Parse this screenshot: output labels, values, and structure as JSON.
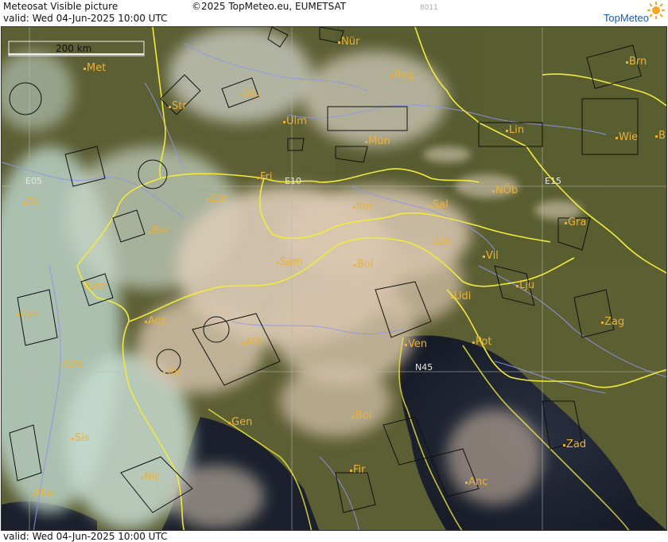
{
  "header": {
    "product": "Meteosat Visible picture",
    "copyright": "©2025 TopMeteo.eu, EUMETSAT",
    "code": "8011",
    "valid": "valid:  Wed  04-Jun-2025  10:00 UTC",
    "logo_text": "TopMeteo"
  },
  "footer": {
    "valid": "valid:  Wed  04-Jun-2025  10:00 UTC"
  },
  "scale_bar": {
    "label": "200 km"
  },
  "grid_labels": {
    "e05": "E05",
    "e10": "E10",
    "e15": "E15",
    "n45": "N45"
  },
  "cities": [
    {
      "name": "Nür"
    },
    {
      "name": "Reg"
    },
    {
      "name": "Brn"
    },
    {
      "name": "Met"
    },
    {
      "name": "Stu"
    },
    {
      "name": "Str"
    },
    {
      "name": "Ulm"
    },
    {
      "name": "Lin"
    },
    {
      "name": "Mün"
    },
    {
      "name": "Wie"
    },
    {
      "name": "B"
    },
    {
      "name": "Fri"
    },
    {
      "name": "Dij"
    },
    {
      "name": "Zür"
    },
    {
      "name": "Inn"
    },
    {
      "name": "Sal"
    },
    {
      "name": "NÖb"
    },
    {
      "name": "Ber"
    },
    {
      "name": "Gra"
    },
    {
      "name": "Lie"
    },
    {
      "name": "Vil"
    },
    {
      "name": "Sam"
    },
    {
      "name": "Bol"
    },
    {
      "name": "Gen"
    },
    {
      "name": "Lju"
    },
    {
      "name": "Udi"
    },
    {
      "name": "Lyo"
    },
    {
      "name": "Aos"
    },
    {
      "name": "Zag"
    },
    {
      "name": "Mil"
    },
    {
      "name": "Gre"
    },
    {
      "name": "Ven"
    },
    {
      "name": "Tor"
    },
    {
      "name": "Pot"
    },
    {
      "name": "Bol"
    },
    {
      "name": "Gen"
    },
    {
      "name": "Sis"
    },
    {
      "name": "Zad"
    },
    {
      "name": "Nic"
    },
    {
      "name": "Fir"
    },
    {
      "name": "Mar"
    },
    {
      "name": "Anc"
    }
  ],
  "colors": {
    "land": "#5f6135",
    "sea": "#1c2230",
    "cloud": "#d9c7b0",
    "border": "#f2ea3c",
    "river": "#8f97e8",
    "city": "#e9b23a"
  }
}
